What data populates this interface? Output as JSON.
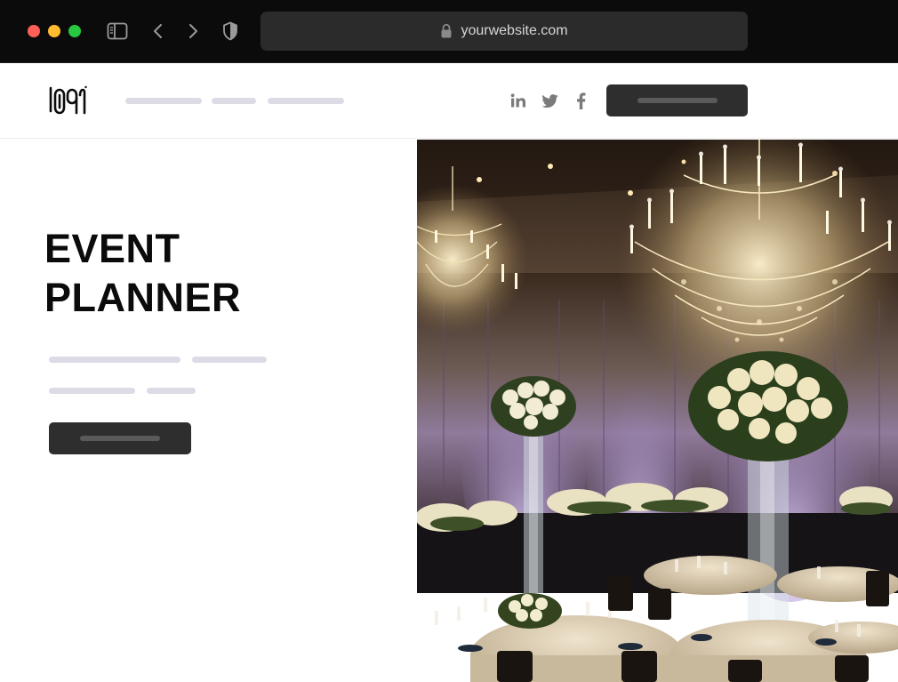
{
  "browser": {
    "url": "yourwebsite.com",
    "traffic_lights": {
      "close": "#fe5f57",
      "minimize": "#febc2e",
      "maximize": "#28c840"
    }
  },
  "header": {
    "social_icons": [
      "linkedin-icon",
      "twitter-icon",
      "facebook-icon"
    ],
    "placeholder_color": "#dcdbe6",
    "button_color": "#2e2e2e"
  },
  "hero": {
    "title_line1": "EVENT",
    "title_line2": "PLANNER",
    "placeholder_color": "#dcdbe6",
    "button_color": "#2e2e2e"
  }
}
